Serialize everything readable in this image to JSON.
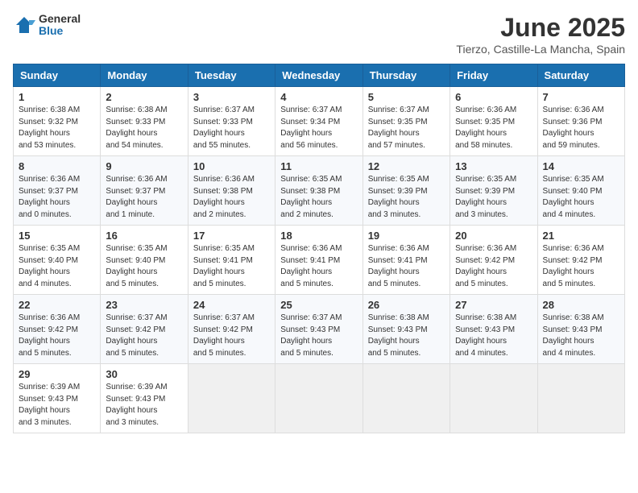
{
  "header": {
    "logo": {
      "general": "General",
      "blue": "Blue"
    },
    "title": "June 2025",
    "subtitle": "Tierzo, Castille-La Mancha, Spain"
  },
  "calendar": {
    "days_of_week": [
      "Sunday",
      "Monday",
      "Tuesday",
      "Wednesday",
      "Thursday",
      "Friday",
      "Saturday"
    ],
    "weeks": [
      [
        null,
        {
          "day": "2",
          "sunrise": "6:38 AM",
          "sunset": "9:33 PM",
          "daylight": "14 hours and 54 minutes."
        },
        {
          "day": "3",
          "sunrise": "6:37 AM",
          "sunset": "9:33 PM",
          "daylight": "14 hours and 55 minutes."
        },
        {
          "day": "4",
          "sunrise": "6:37 AM",
          "sunset": "9:34 PM",
          "daylight": "14 hours and 56 minutes."
        },
        {
          "day": "5",
          "sunrise": "6:37 AM",
          "sunset": "9:35 PM",
          "daylight": "14 hours and 57 minutes."
        },
        {
          "day": "6",
          "sunrise": "6:36 AM",
          "sunset": "9:35 PM",
          "daylight": "14 hours and 58 minutes."
        },
        {
          "day": "7",
          "sunrise": "6:36 AM",
          "sunset": "9:36 PM",
          "daylight": "14 hours and 59 minutes."
        }
      ],
      [
        {
          "day": "1",
          "sunrise": "6:38 AM",
          "sunset": "9:32 PM",
          "daylight": "14 hours and 53 minutes."
        },
        {
          "day": "9",
          "sunrise": "6:36 AM",
          "sunset": "9:37 PM",
          "daylight": "15 hours and 1 minute."
        },
        {
          "day": "10",
          "sunrise": "6:36 AM",
          "sunset": "9:38 PM",
          "daylight": "15 hours and 2 minutes."
        },
        {
          "day": "11",
          "sunrise": "6:35 AM",
          "sunset": "9:38 PM",
          "daylight": "15 hours and 2 minutes."
        },
        {
          "day": "12",
          "sunrise": "6:35 AM",
          "sunset": "9:39 PM",
          "daylight": "15 hours and 3 minutes."
        },
        {
          "day": "13",
          "sunrise": "6:35 AM",
          "sunset": "9:39 PM",
          "daylight": "15 hours and 3 minutes."
        },
        {
          "day": "14",
          "sunrise": "6:35 AM",
          "sunset": "9:40 PM",
          "daylight": "15 hours and 4 minutes."
        }
      ],
      [
        {
          "day": "8",
          "sunrise": "6:36 AM",
          "sunset": "9:37 PM",
          "daylight": "15 hours and 0 minutes."
        },
        {
          "day": "16",
          "sunrise": "6:35 AM",
          "sunset": "9:40 PM",
          "daylight": "15 hours and 5 minutes."
        },
        {
          "day": "17",
          "sunrise": "6:35 AM",
          "sunset": "9:41 PM",
          "daylight": "15 hours and 5 minutes."
        },
        {
          "day": "18",
          "sunrise": "6:36 AM",
          "sunset": "9:41 PM",
          "daylight": "15 hours and 5 minutes."
        },
        {
          "day": "19",
          "sunrise": "6:36 AM",
          "sunset": "9:41 PM",
          "daylight": "15 hours and 5 minutes."
        },
        {
          "day": "20",
          "sunrise": "6:36 AM",
          "sunset": "9:42 PM",
          "daylight": "15 hours and 5 minutes."
        },
        {
          "day": "21",
          "sunrise": "6:36 AM",
          "sunset": "9:42 PM",
          "daylight": "15 hours and 5 minutes."
        }
      ],
      [
        {
          "day": "15",
          "sunrise": "6:35 AM",
          "sunset": "9:40 PM",
          "daylight": "15 hours and 4 minutes."
        },
        {
          "day": "23",
          "sunrise": "6:37 AM",
          "sunset": "9:42 PM",
          "daylight": "15 hours and 5 minutes."
        },
        {
          "day": "24",
          "sunrise": "6:37 AM",
          "sunset": "9:42 PM",
          "daylight": "15 hours and 5 minutes."
        },
        {
          "day": "25",
          "sunrise": "6:37 AM",
          "sunset": "9:43 PM",
          "daylight": "15 hours and 5 minutes."
        },
        {
          "day": "26",
          "sunrise": "6:38 AM",
          "sunset": "9:43 PM",
          "daylight": "15 hours and 5 minutes."
        },
        {
          "day": "27",
          "sunrise": "6:38 AM",
          "sunset": "9:43 PM",
          "daylight": "15 hours and 4 minutes."
        },
        {
          "day": "28",
          "sunrise": "6:38 AM",
          "sunset": "9:43 PM",
          "daylight": "15 hours and 4 minutes."
        }
      ],
      [
        {
          "day": "22",
          "sunrise": "6:36 AM",
          "sunset": "9:42 PM",
          "daylight": "15 hours and 5 minutes."
        },
        {
          "day": "30",
          "sunrise": "6:39 AM",
          "sunset": "9:43 PM",
          "daylight": "15 hours and 3 minutes."
        },
        null,
        null,
        null,
        null,
        null
      ],
      [
        {
          "day": "29",
          "sunrise": "6:39 AM",
          "sunset": "9:43 PM",
          "daylight": "15 hours and 3 minutes."
        },
        null,
        null,
        null,
        null,
        null,
        null
      ]
    ]
  }
}
